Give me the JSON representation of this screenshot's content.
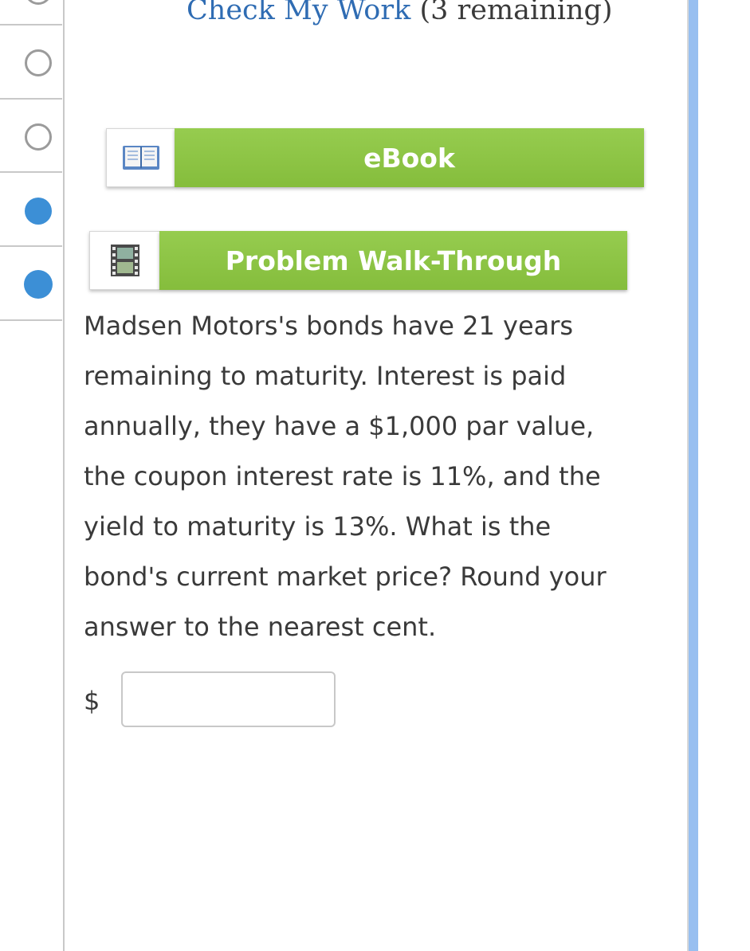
{
  "header": {
    "check_link": "Check My Work",
    "remaining": "(3 remaining)"
  },
  "nav": {
    "options": [
      {
        "state": "unselected"
      },
      {
        "state": "unselected"
      },
      {
        "state": "selected"
      },
      {
        "state": "selected"
      }
    ]
  },
  "resources": {
    "ebook": {
      "label": "eBook",
      "icon": "book-icon"
    },
    "walkthrough": {
      "label": "Problem Walk-Through",
      "icon": "film-icon"
    }
  },
  "question": {
    "lines": [
      "Madsen Motors's bonds have 21 years",
      "remaining to maturity. Interest is paid",
      "annually, they have a $1,000 par value,",
      "the coupon interest rate is 11%, and the",
      "yield to maturity is 13%. What is the",
      "bond's current market price? Round your",
      "answer to the nearest cent."
    ]
  },
  "answer": {
    "currency_symbol": "$",
    "value": ""
  },
  "colors": {
    "link": "#2f6cb3",
    "button_green": "#8cc444",
    "radio_selected": "#3c8fd6",
    "accent_bar": "#98bff0"
  }
}
